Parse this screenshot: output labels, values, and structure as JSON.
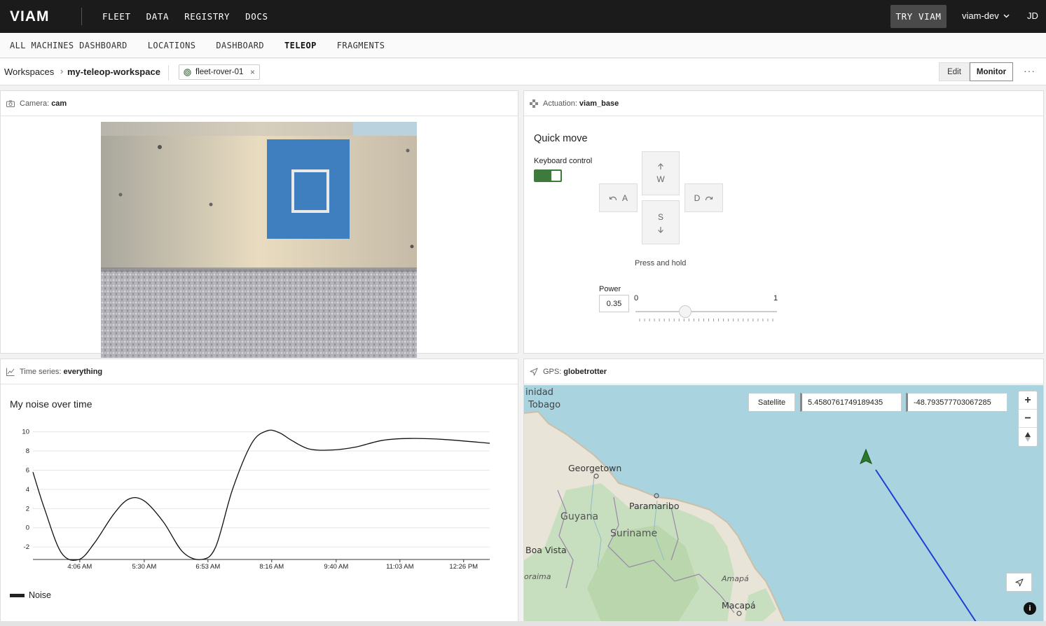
{
  "nav": {
    "logo": "VIAM",
    "links": [
      "FLEET",
      "DATA",
      "REGISTRY",
      "DOCS"
    ],
    "try_label": "TRY VIAM",
    "org": "viam-dev",
    "user_initials": "JD"
  },
  "subnav": {
    "links": [
      "ALL MACHINES DASHBOARD",
      "LOCATIONS",
      "DASHBOARD",
      "TELEOP",
      "FRAGMENTS"
    ],
    "active": "TELEOP"
  },
  "breadcrumb": {
    "root": "Workspaces",
    "current": "my-teleop-workspace",
    "machine_chip": "fleet-rover-01",
    "edit_label": "Edit",
    "monitor_label": "Monitor",
    "more": "···"
  },
  "camera": {
    "type_label": "Camera:",
    "name": "cam",
    "icon": "camera-icon"
  },
  "actuation": {
    "type_label": "Actuation:",
    "name": "viam_base",
    "icon": "gamepad-icon",
    "title": "Quick move",
    "keyboard_label": "Keyboard control",
    "keyboard_on": true,
    "keys": {
      "up": "W",
      "left": "A",
      "down": "S",
      "right": "D"
    },
    "hint": "Press and hold",
    "power_label": "Power",
    "power_value": "0.35",
    "power_min": "0",
    "power_max": "1",
    "power_fraction": 0.35,
    "accent": "#3f7a3d"
  },
  "timeseries": {
    "type_label": "Time series:",
    "name": "everything",
    "icon": "line-chart-icon",
    "title": "My noise over time",
    "legend": "Noise"
  },
  "chart_data": {
    "type": "line",
    "title": "My noise over time",
    "xlabel": "",
    "ylabel": "",
    "x_ticks": [
      "4:06 AM",
      "5:30 AM",
      "6:53 AM",
      "8:16 AM",
      "9:40 AM",
      "11:03 AM",
      "12:26 PM"
    ],
    "y_ticks": [
      -2,
      0,
      2,
      4,
      6,
      8,
      10
    ],
    "ylim": [
      -3.3,
      10.7
    ],
    "xlim_minutes": [
      185,
      780
    ],
    "series": [
      {
        "name": "Noise",
        "x_minutes": [
          185,
          200,
          222,
          245,
          265,
          290,
          310,
          330,
          355,
          380,
          404,
          423,
          445,
          470,
          490,
          506,
          522,
          545,
          575,
          605,
          640,
          675,
          720,
          780
        ],
        "values": [
          5.8,
          2.0,
          -2.6,
          -3.3,
          -1.6,
          1.4,
          3.0,
          2.8,
          0.6,
          -2.5,
          -3.3,
          -2.0,
          4.0,
          8.8,
          10.1,
          9.9,
          9.1,
          8.2,
          8.1,
          8.4,
          9.1,
          9.3,
          9.2,
          8.8
        ]
      }
    ],
    "grid": true,
    "legend": "bottom-left"
  },
  "gps": {
    "type_label": "GPS:",
    "name": "globetrotter",
    "icon": "navigation-icon",
    "layer_button": "Satellite",
    "lat": "5.4580761749189435",
    "lng": "-48.793577703067285",
    "zoom_in": "+",
    "zoom_out": "−",
    "map_labels": [
      "inidad",
      "Tobago",
      "Georgetown",
      "Paramaribo",
      "Guyana",
      "Suriname",
      "Boa Vista",
      "oraima",
      "Amapá",
      "Macapá"
    ]
  }
}
